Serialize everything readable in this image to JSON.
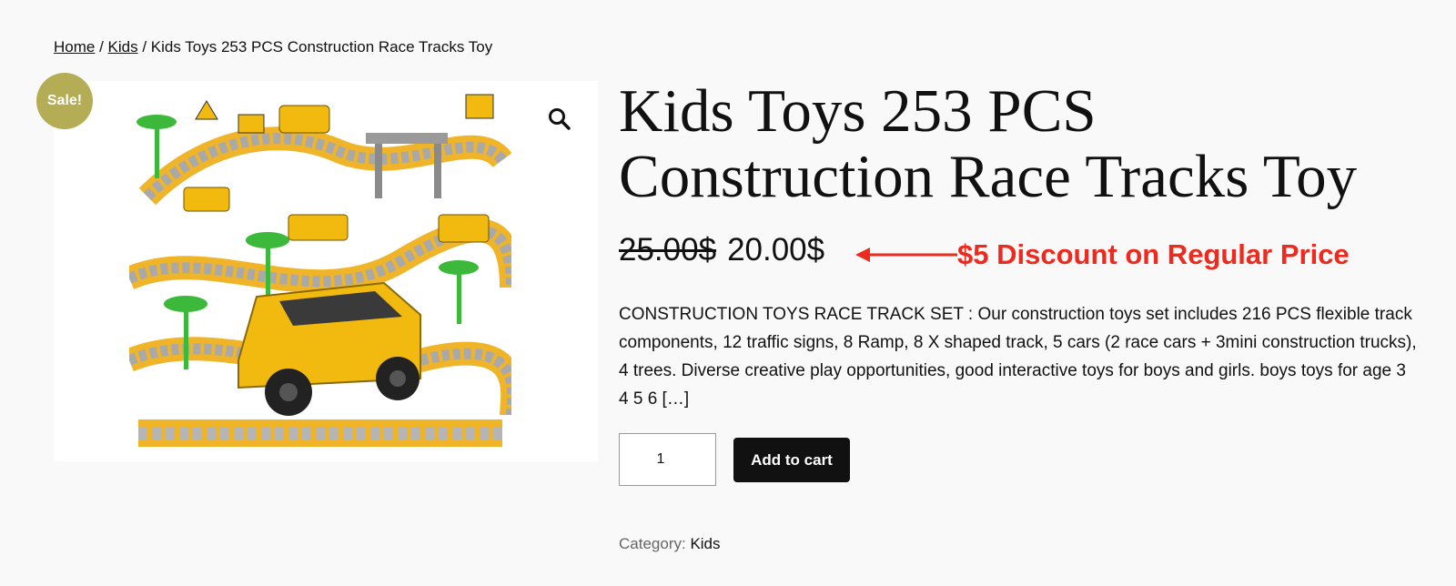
{
  "breadcrumb": {
    "home": "Home",
    "sep1": " / ",
    "category": "Kids",
    "sep2": " / ",
    "current": "Kids Toys 253 PCS Construction Race Tracks Toy"
  },
  "badge": {
    "sale": "Sale!"
  },
  "product": {
    "title": "Kids Toys 253 PCS Construction Race Tracks Toy",
    "regular_price": "25.00$",
    "sale_price": "20.00$",
    "description": "CONSTRUCTION TOYS RACE TRACK SET : Our construction toys set includes 216 PCS flexible track components, 12 traffic signs, 8 Ramp, 8 X shaped track, 5 cars (2 race cars + 3mini construction trucks), 4 trees. Diverse creative play opportunities, good interactive toys for boys and girls. boys toys for age 3 4 5 6 […]",
    "quantity": "1",
    "add_to_cart_label": "Add to cart",
    "category_label": "Category:",
    "category_value": "Kids"
  },
  "annotation": {
    "text": "$5 Discount on Regular Price",
    "color": "#ee2a1e"
  },
  "colors": {
    "sale_badge": "#b5ad55",
    "button_bg": "#111111",
    "page_bg": "#f9f9f9"
  },
  "icons": {
    "zoom": "magnifying-glass-icon"
  }
}
